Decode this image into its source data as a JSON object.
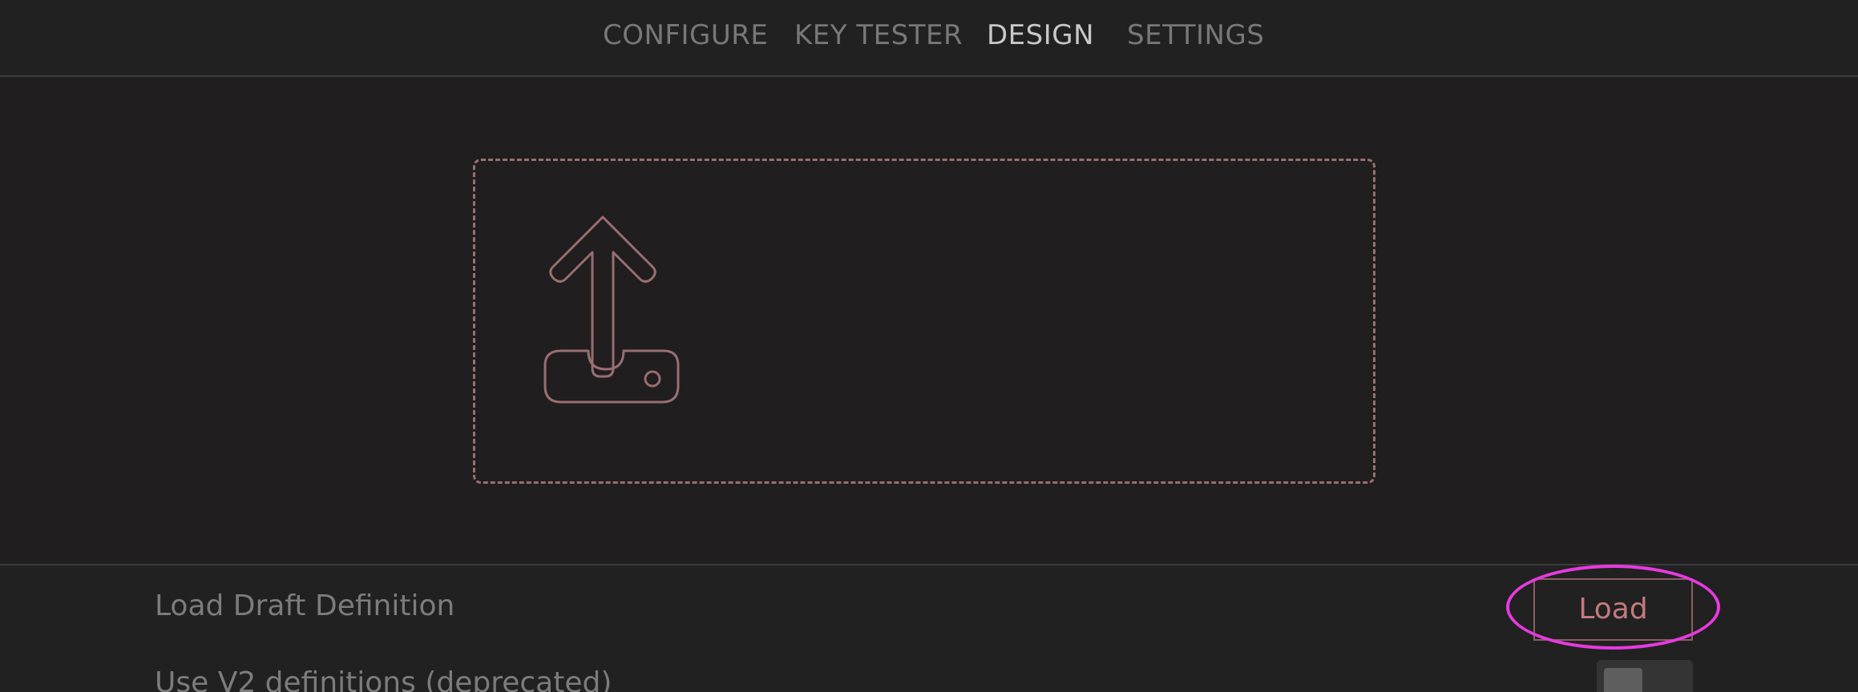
{
  "nav": {
    "tabs": [
      {
        "label": "CONFIGURE",
        "active": false
      },
      {
        "label": "KEY TESTER",
        "active": false
      },
      {
        "label": "DESIGN",
        "active": true
      },
      {
        "label": "SETTINGS",
        "active": false
      }
    ]
  },
  "upload": {
    "icon": "upload-tray-icon",
    "accent_color": "#9a6e70"
  },
  "settings": {
    "load_draft": {
      "label": "Load Draft Definition",
      "button_label": "Load"
    },
    "v2_definitions": {
      "label": "Use V2 definitions (deprecated)",
      "enabled": false
    }
  },
  "colors": {
    "background": "#201e1f",
    "highlight": "#e73ae0",
    "button_text": "#c47a7e"
  }
}
